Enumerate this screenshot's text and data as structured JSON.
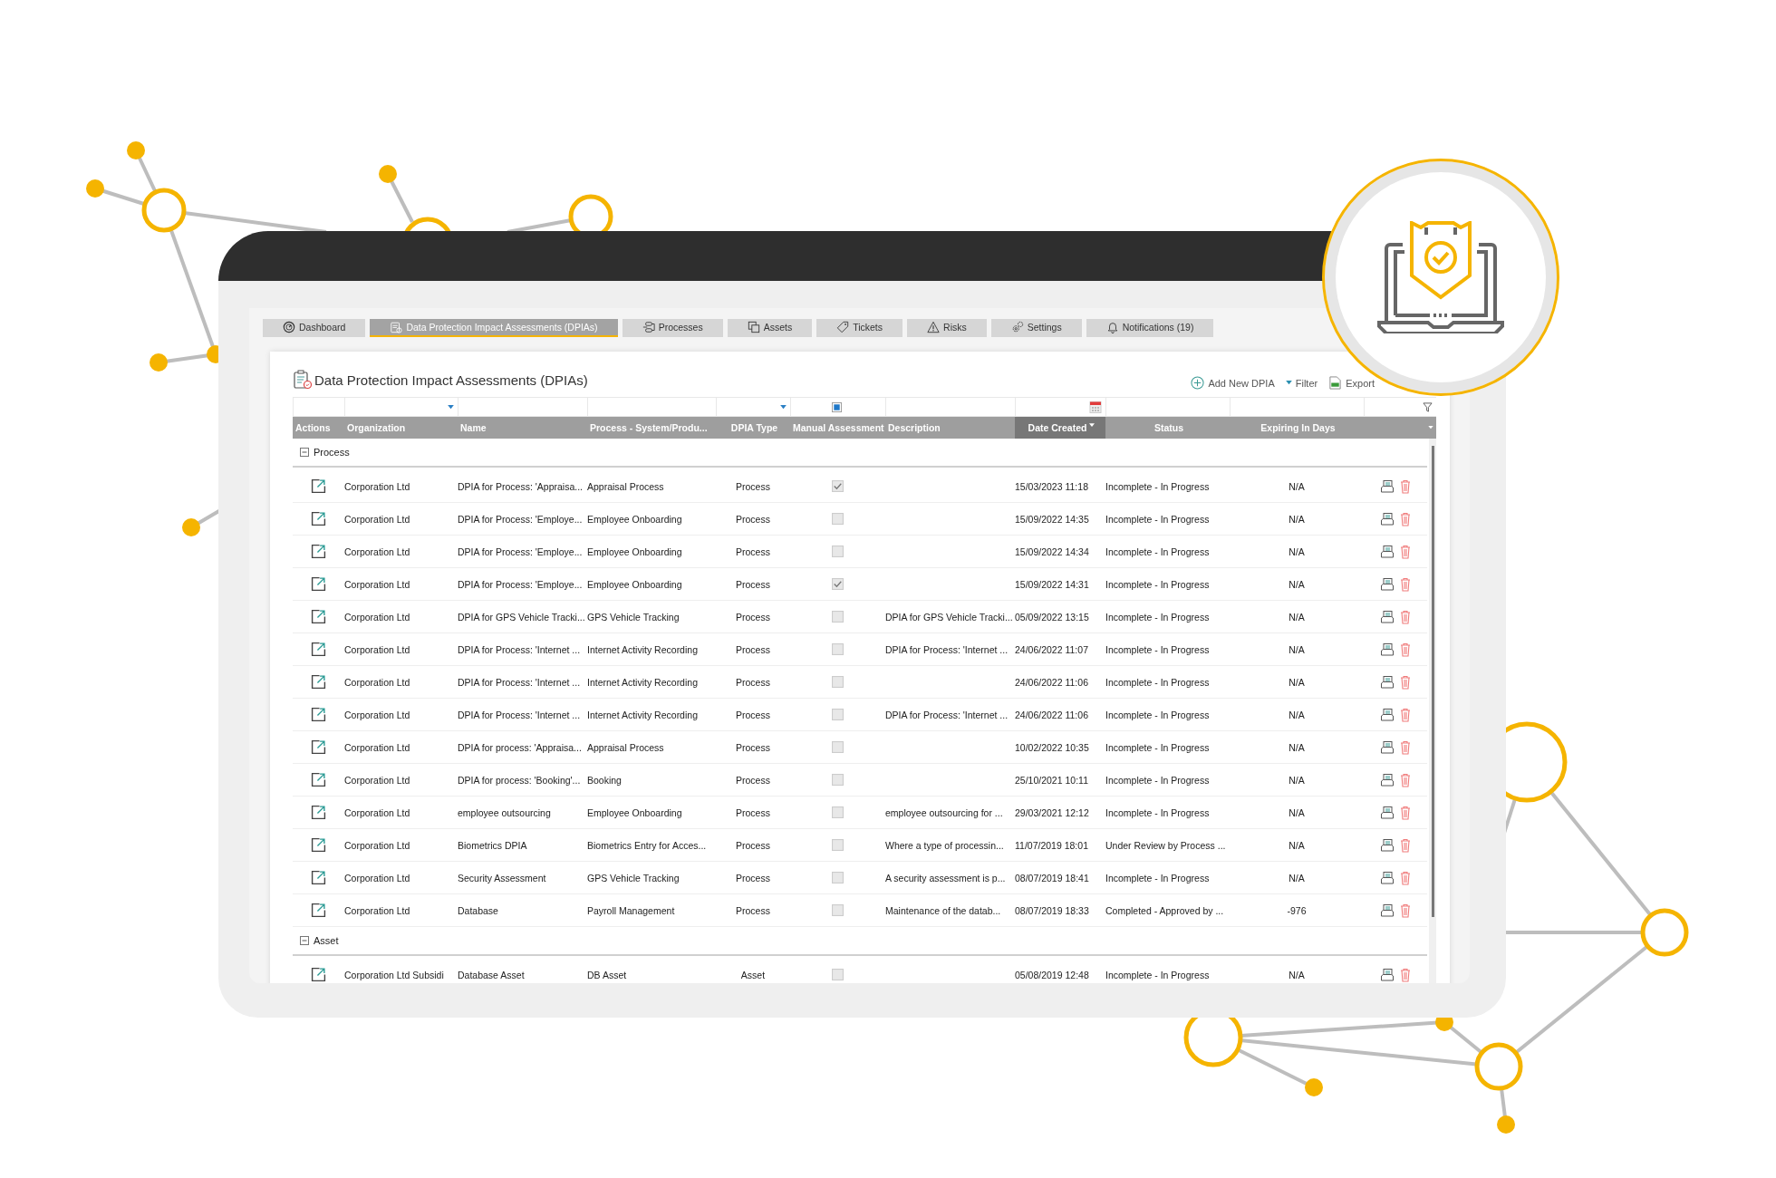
{
  "tabs": [
    {
      "label": "Dashboard",
      "selected": false
    },
    {
      "label": "Data Protection Impact Assessments (DPIAs)",
      "selected": true
    },
    {
      "label": "Processes",
      "selected": false
    },
    {
      "label": "Assets",
      "selected": false
    },
    {
      "label": "Tickets",
      "selected": false
    },
    {
      "label": "Risks",
      "selected": false
    },
    {
      "label": "Settings",
      "selected": false
    },
    {
      "label": "Notifications (19)",
      "selected": false
    }
  ],
  "page_title": "Data Protection Impact Assessments (DPIAs)",
  "toolbar": {
    "add": "Add New DPIA",
    "filter": "Filter",
    "export": "Export"
  },
  "columns": [
    {
      "label": "Actions",
      "sorted": false
    },
    {
      "label": "Organization",
      "sorted": false
    },
    {
      "label": "Name",
      "sorted": false
    },
    {
      "label": "Process - System/Produ...",
      "sorted": false
    },
    {
      "label": "DPIA Type",
      "sorted": false
    },
    {
      "label": "Manual Assessment",
      "sorted": false
    },
    {
      "label": "Description",
      "sorted": false
    },
    {
      "label": "Date Created",
      "sorted": true
    },
    {
      "label": "Status",
      "sorted": false
    },
    {
      "label": "Expiring In Days",
      "sorted": false
    }
  ],
  "groups": [
    {
      "label": "Process",
      "expanded": true,
      "rows": [
        {
          "organization": "Corporation Ltd",
          "name": "DPIA for Process: 'Appraisa...",
          "process": "Appraisal Process",
          "type": "Process",
          "manual": true,
          "description": "",
          "date": "15/03/2023 11:18",
          "status": "Incomplete - In Progress",
          "expiring": "N/A"
        },
        {
          "organization": "Corporation Ltd",
          "name": "DPIA for Process: 'Employe...",
          "process": "Employee Onboarding",
          "type": "Process",
          "manual": false,
          "description": "",
          "date": "15/09/2022 14:35",
          "status": "Incomplete - In Progress",
          "expiring": "N/A"
        },
        {
          "organization": "Corporation Ltd",
          "name": "DPIA for Process: 'Employe...",
          "process": "Employee Onboarding",
          "type": "Process",
          "manual": false,
          "description": "",
          "date": "15/09/2022 14:34",
          "status": "Incomplete - In Progress",
          "expiring": "N/A"
        },
        {
          "organization": "Corporation Ltd",
          "name": "DPIA for Process: 'Employe...",
          "process": "Employee Onboarding",
          "type": "Process",
          "manual": true,
          "description": "",
          "date": "15/09/2022 14:31",
          "status": "Incomplete - In Progress",
          "expiring": "N/A"
        },
        {
          "organization": "Corporation Ltd",
          "name": "DPIA for GPS Vehicle Tracki...",
          "process": "GPS Vehicle Tracking",
          "type": "Process",
          "manual": false,
          "description": "DPIA for GPS Vehicle Tracki...",
          "date": "05/09/2022 13:15",
          "status": "Incomplete - In Progress",
          "expiring": "N/A"
        },
        {
          "organization": "Corporation Ltd",
          "name": "DPIA for Process: 'Internet ...",
          "process": "Internet Activity Recording",
          "type": "Process",
          "manual": false,
          "description": "DPIA for Process: 'Internet ...",
          "date": "24/06/2022 11:07",
          "status": "Incomplete - In Progress",
          "expiring": "N/A"
        },
        {
          "organization": "Corporation Ltd",
          "name": "DPIA for Process: 'Internet ...",
          "process": "Internet Activity Recording",
          "type": "Process",
          "manual": false,
          "description": "",
          "date": "24/06/2022 11:06",
          "status": "Incomplete - In Progress",
          "expiring": "N/A"
        },
        {
          "organization": "Corporation Ltd",
          "name": "DPIA for Process: 'Internet ...",
          "process": "Internet Activity Recording",
          "type": "Process",
          "manual": false,
          "description": "DPIA for Process: 'Internet ...",
          "date": "24/06/2022 11:06",
          "status": "Incomplete - In Progress",
          "expiring": "N/A"
        },
        {
          "organization": "Corporation Ltd",
          "name": "DPIA for process: 'Appraisa...",
          "process": "Appraisal Process",
          "type": "Process",
          "manual": false,
          "description": "",
          "date": "10/02/2022 10:35",
          "status": "Incomplete - In Progress",
          "expiring": "N/A"
        },
        {
          "organization": "Corporation Ltd",
          "name": "DPIA for process: 'Booking'...",
          "process": "Booking",
          "type": "Process",
          "manual": false,
          "description": "",
          "date": "25/10/2021 10:11",
          "status": "Incomplete - In Progress",
          "expiring": "N/A"
        },
        {
          "organization": "Corporation Ltd",
          "name": "employee outsourcing",
          "process": "Employee Onboarding",
          "type": "Process",
          "manual": false,
          "description": "employee outsourcing for ...",
          "date": "29/03/2021 12:12",
          "status": "Incomplete - In Progress",
          "expiring": "N/A"
        },
        {
          "organization": "Corporation Ltd",
          "name": "Biometrics DPIA",
          "process": "Biometrics Entry for Acces...",
          "type": "Process",
          "manual": false,
          "description": "Where a type of processin...",
          "date": "11/07/2019 18:01",
          "status": "Under Review by Process ...",
          "expiring": "N/A"
        },
        {
          "organization": "Corporation Ltd",
          "name": "Security Assessment",
          "process": "GPS Vehicle Tracking",
          "type": "Process",
          "manual": false,
          "description": "A security assessment is p...",
          "date": "08/07/2019 18:41",
          "status": "Incomplete - In Progress",
          "expiring": "N/A"
        },
        {
          "organization": "Corporation Ltd",
          "name": "Database",
          "process": "Payroll Management",
          "type": "Process",
          "manual": false,
          "description": "Maintenance of the datab...",
          "date": "08/07/2019 18:33",
          "status": "Completed - Approved by ...",
          "expiring": "-976"
        }
      ]
    },
    {
      "label": "Asset",
      "expanded": true,
      "rows": [
        {
          "organization": "Corporation Ltd Subsidi",
          "name": "Database Asset",
          "process": "DB Asset",
          "type": "Asset",
          "manual": false,
          "description": "",
          "date": "05/08/2019 12:48",
          "status": "Incomplete - In Progress",
          "expiring": "N/A"
        }
      ]
    }
  ]
}
